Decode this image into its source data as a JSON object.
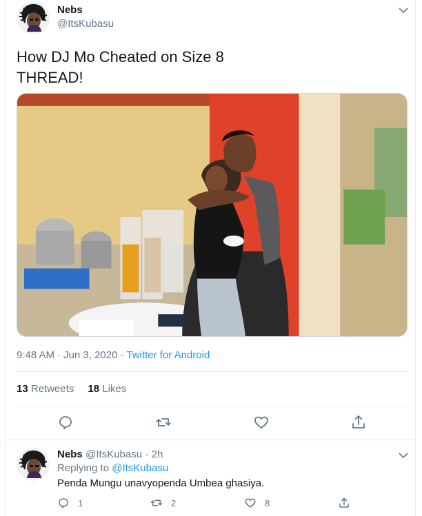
{
  "tweet": {
    "author_name": "Nebs",
    "author_handle": "@ItsKubasu",
    "text_line1": "How DJ Mo Cheated on Size 8",
    "text_line2": "THREAD!",
    "time": "9:48 AM",
    "date": "Jun 3, 2020",
    "separator": "·",
    "source": "Twitter for Android",
    "retweets_count": "13",
    "retweets_label": "Retweets",
    "likes_count": "18",
    "likes_label": "Likes",
    "icons": [
      "reply-icon",
      "retweet-icon",
      "like-icon",
      "share-icon",
      "chevron-down-icon"
    ]
  },
  "reply": {
    "author_name": "Nebs",
    "author_handle": "@ItsKubasu",
    "time": "· 2h",
    "replying_prefix": "Replying to",
    "replying_to": "@ItsKubasu",
    "text": "Penda Mungu unavyopenda Umbea ghasiya.",
    "reply_count": "1",
    "retweet_count": "2",
    "like_count": "8"
  },
  "colors": {
    "text": "#14171a",
    "secondary": "#657786",
    "link": "#1b95e0",
    "divider": "#e6ecf0"
  }
}
